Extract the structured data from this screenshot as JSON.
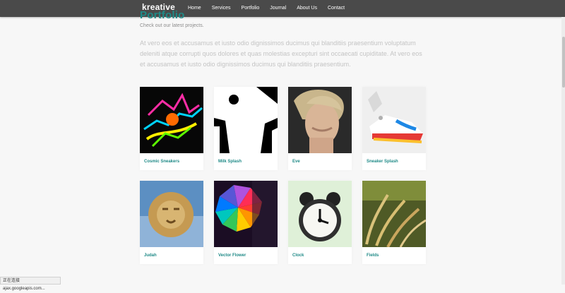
{
  "brand": "kreative",
  "nav": [
    "Home",
    "Services",
    "Portfolio",
    "Journal",
    "About Us",
    "Contact"
  ],
  "page": {
    "title": "Portfolio",
    "subtitle": "Check out our latest projects.",
    "intro": "At vero eos et accusamus et iusto odio dignissimos ducimus qui blanditiis praesentium voluptatum deleniti atque corrupti quos dolores et quas molestias excepturi sint occaecati cupiditate. At vero eos et accusamus et iusto odio dignissimos ducimus qui blanditiis praesentium."
  },
  "portfolio": [
    {
      "label": "Cosmic Sneakers"
    },
    {
      "label": "Milk Splash"
    },
    {
      "label": "Eve"
    },
    {
      "label": "Sneaker Splash"
    },
    {
      "label": "Judah"
    },
    {
      "label": "Vector Flower"
    },
    {
      "label": "Clock"
    },
    {
      "label": "Fields"
    }
  ],
  "status_bar": "正在连接 ajax.googleapis.com..."
}
